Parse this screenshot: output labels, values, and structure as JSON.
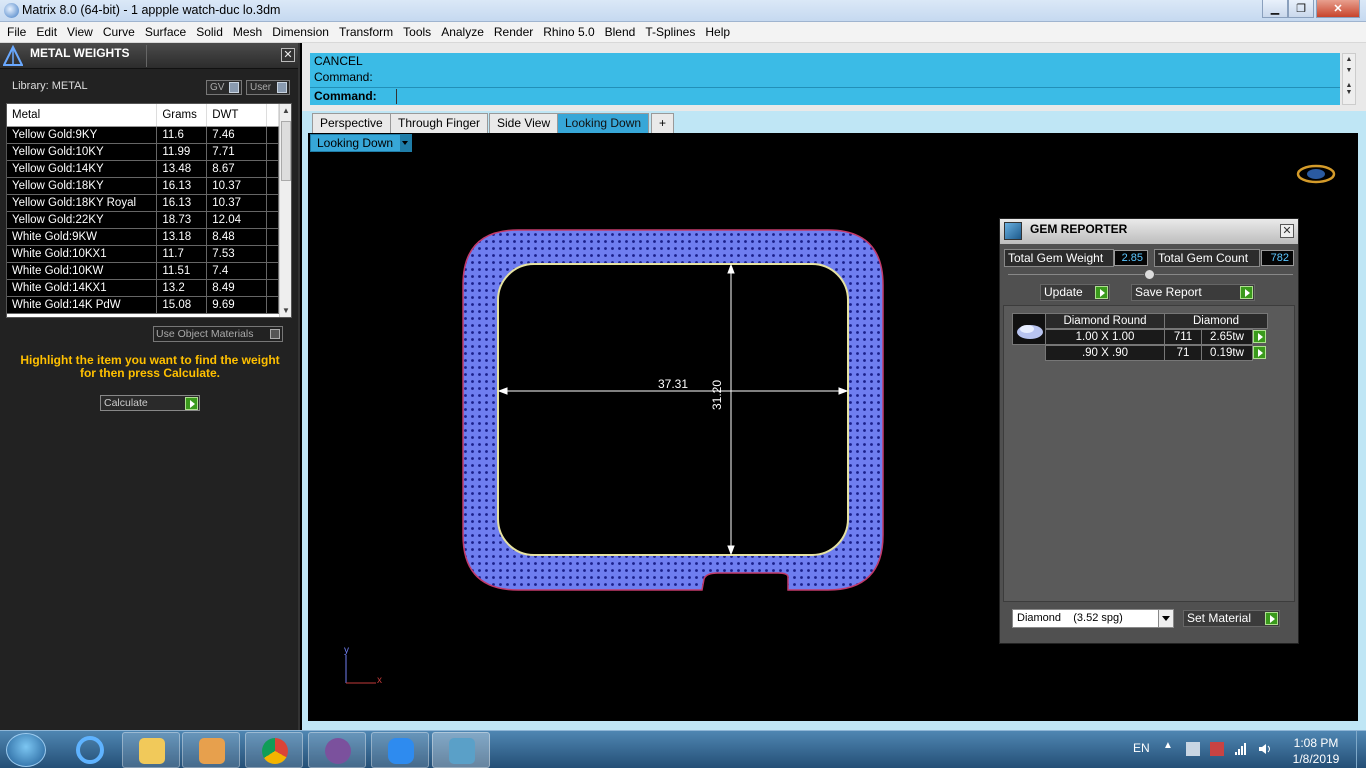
{
  "window": {
    "title": "Matrix 8.0 (64-bit) - 1 appple watch-duc lo.3dm",
    "minimize": "▁",
    "maximize": "❐",
    "close": "✕"
  },
  "menubar": [
    "File",
    "Edit",
    "View",
    "Curve",
    "Surface",
    "Solid",
    "Mesh",
    "Dimension",
    "Transform",
    "Tools",
    "Analyze",
    "Render",
    "Rhino 5.0",
    "Blend",
    "T-Splines",
    "Help"
  ],
  "metal_panel": {
    "title": "METAL WEIGHTS",
    "close": "✕",
    "library_label": "Library: METAL",
    "toggle_gv": "GV",
    "toggle_user": "User",
    "columns": [
      "Metal",
      "Grams",
      "DWT"
    ],
    "rows": [
      [
        "Yellow Gold:9KY",
        "11.6",
        "7.46"
      ],
      [
        "Yellow Gold:10KY",
        "11.99",
        "7.71"
      ],
      [
        "Yellow Gold:14KY",
        "13.48",
        "8.67"
      ],
      [
        "Yellow Gold:18KY",
        "16.13",
        "10.37"
      ],
      [
        "Yellow Gold:18KY Royal",
        "16.13",
        "10.37"
      ],
      [
        "Yellow Gold:22KY",
        "18.73",
        "12.04"
      ],
      [
        "White Gold:9KW",
        "13.18",
        "8.48"
      ],
      [
        "White Gold:10KX1",
        "11.7",
        "7.53"
      ],
      [
        "White Gold:10KW",
        "11.51",
        "7.4"
      ],
      [
        "White Gold:14KX1",
        "13.2",
        "8.49"
      ],
      [
        "White Gold:14K PdW",
        "15.08",
        "9.69"
      ]
    ],
    "use_object_materials": "Use Object Materials",
    "hint": "Highlight the item you want to find the weight for then press Calculate.",
    "calculate": "Calculate"
  },
  "command": {
    "history": [
      "CANCEL",
      "Command:"
    ],
    "prompt": "Command:",
    "value": ""
  },
  "tabs": [
    "Perspective",
    "Through Finger",
    "Side View",
    "Looking Down",
    "+"
  ],
  "active_tab": "Looking Down",
  "viewport": {
    "view_name": "Looking Down",
    "dim_width": "37.31",
    "dim_height": "31.20",
    "axis_y": "y",
    "axis_x": "x"
  },
  "gem_reporter": {
    "title": "GEM REPORTER",
    "close": "✕",
    "total_weight_label": "Total Gem Weight",
    "total_weight": "2.85",
    "total_count_label": "Total Gem Count",
    "total_count": "782",
    "update": "Update",
    "save_report": "Save Report",
    "table_header": [
      "Diamond Round",
      "Diamond"
    ],
    "rows": [
      {
        "size": "1.00 X 1.00",
        "count": "711",
        "weight": "2.65tw"
      },
      {
        "size": ".90 X .90",
        "count": "71",
        "weight": "0.19tw"
      }
    ],
    "material": "Diamond    (3.52 spg)",
    "set_material": "Set Material"
  },
  "taskbar": {
    "lang": "EN",
    "time": "1:08 PM",
    "date": "1/8/2019"
  },
  "colors": {
    "accent": "#3bbbe6",
    "gem_blue": "#7a86f5",
    "metal_table_bg": "#000000",
    "hint": "#ffc000"
  }
}
